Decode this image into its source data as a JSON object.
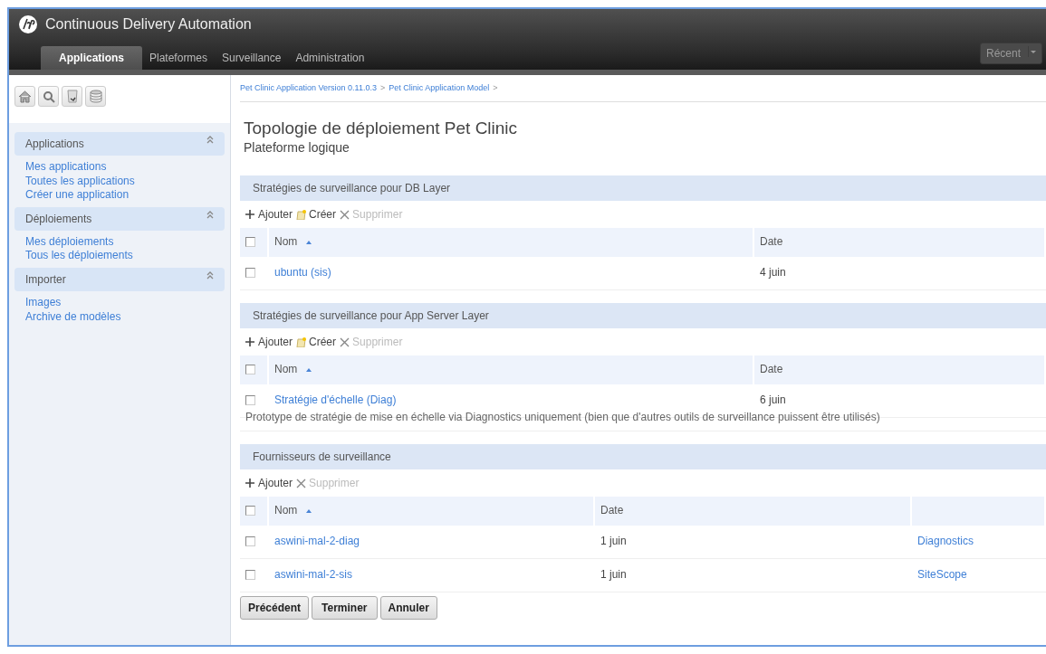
{
  "app_title": "Continuous Delivery Automation",
  "tabs": [
    {
      "label": "Applications",
      "selected": true
    },
    {
      "label": "Plateformes",
      "selected": false
    },
    {
      "label": "Surveillance",
      "selected": false
    },
    {
      "label": "Administration",
      "selected": false
    }
  ],
  "recent_button": {
    "label": "Récent"
  },
  "sidebar": {
    "sections": [
      {
        "title": "Applications",
        "expanded": true,
        "links": [
          "Mes applications",
          "Toutes les applications",
          "Créer une application"
        ]
      },
      {
        "title": "Déploiements",
        "expanded": true,
        "links": [
          "Mes déploiements",
          "Tous les déploiements"
        ]
      },
      {
        "title": "Importer",
        "expanded": true,
        "links": [
          "Images",
          "Archive de modèles"
        ]
      }
    ]
  },
  "breadcrumb": [
    {
      "label": "Pet Clinic Application Version 0.11.0.3",
      "separator": ">"
    },
    {
      "label": "Pet Clinic Application Model",
      "separator": ">"
    }
  ],
  "page_title": "Topologie de déploiement Pet Clinic",
  "page_subtitle": "Plateforme logique",
  "panels": [
    {
      "title": "Stratégies de surveillance pour DB Layer",
      "actions": [
        {
          "kind": "add",
          "label": "Ajouter",
          "disabled": false
        },
        {
          "kind": "create",
          "label": "Créer",
          "disabled": false
        },
        {
          "kind": "delete",
          "label": "Supprimer",
          "disabled": true
        }
      ],
      "columns": [
        "Nom",
        "Date"
      ],
      "header_checked": false,
      "rows": [
        {
          "checked": false,
          "name": "ubuntu (sis)",
          "date": "4 juin"
        }
      ]
    },
    {
      "title": "Stratégies de surveillance pour App Server Layer",
      "actions": [
        {
          "kind": "add",
          "label": "Ajouter",
          "disabled": false
        },
        {
          "kind": "create",
          "label": "Créer",
          "disabled": false
        },
        {
          "kind": "delete",
          "label": "Supprimer",
          "disabled": true
        }
      ],
      "columns": [
        "Nom",
        "Date"
      ],
      "header_checked": false,
      "rows": [
        {
          "checked": false,
          "name": "Stratégie d'échelle",
          "tag": "(Diag)",
          "date": "6 juin",
          "description": "Prototype de stratégie de mise en échelle via Diagnostics uniquement (bien que d'autres outils de surveillance puissent être utilisés)"
        }
      ]
    },
    {
      "title": "Fournisseurs de surveillance",
      "actions": [
        {
          "kind": "add",
          "label": "Ajouter",
          "disabled": false
        },
        {
          "kind": "delete",
          "label": "Supprimer",
          "disabled": true
        }
      ],
      "columns": [
        "Nom",
        "Date"
      ],
      "header_checked": false,
      "rows": [
        {
          "checked": false,
          "name": "aswini-mal-2-diag",
          "date": "1 juin",
          "column_3": "Diagnostics"
        },
        {
          "checked": false,
          "name": "aswini-mal-2-sis",
          "date": "1 juin",
          "column_3": "SiteScope"
        }
      ]
    }
  ],
  "buttons": [
    "Précédent",
    "Terminer",
    "Annuler"
  ]
}
